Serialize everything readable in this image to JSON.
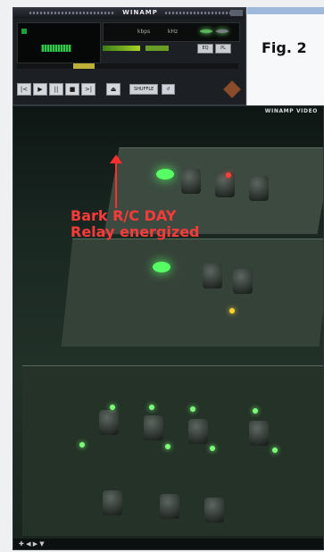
{
  "winamp": {
    "title": "WINAMP",
    "info": {
      "kbps": "kbps",
      "khz": "kHz"
    },
    "eq_label": "EQ",
    "pl_label": "PL",
    "controls": [
      "|<",
      "▶",
      "||",
      "■",
      ">|"
    ],
    "eject": "⏏",
    "shuffle": "SHUFFLE",
    "repeat": "↺",
    "seek_progress": 0.28
  },
  "figure": {
    "label": "Fig. 2"
  },
  "video": {
    "title": "WINAMP VIDEO",
    "annotation_lines": [
      "Bark R/C DAY",
      "Relay energized"
    ],
    "bottom_controls": "✚ ◀ ▶ ▼"
  },
  "colors": {
    "annotation": "#ff3a3a",
    "led_green": "#7bff78"
  }
}
